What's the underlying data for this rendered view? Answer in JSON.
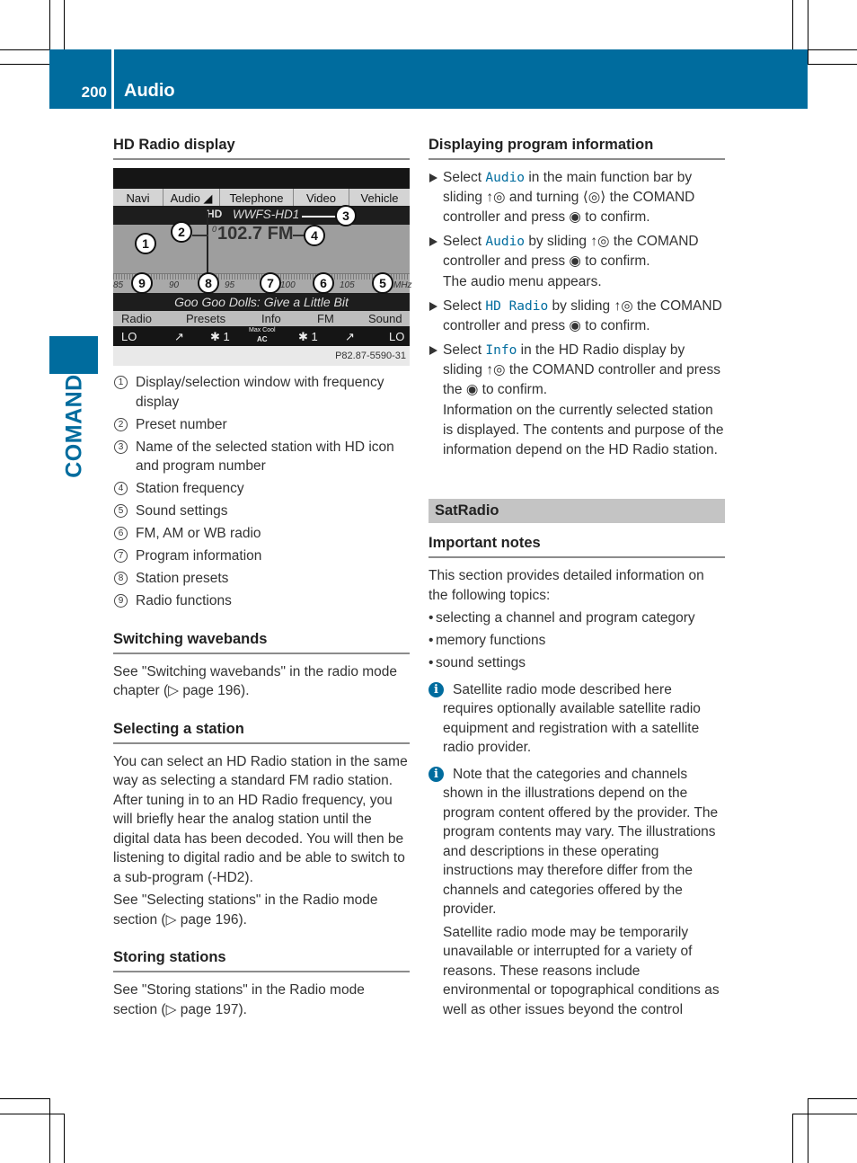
{
  "header": {
    "page_number": "200",
    "title": "Audio"
  },
  "side_tab": {
    "label": "COMAND"
  },
  "left": {
    "hd_display": {
      "heading": "HD Radio display",
      "screen": {
        "menu": [
          "Navi",
          "Audio ◢",
          "Telephone",
          "Video",
          "Vehicle"
        ],
        "station_name": "WWFS-HD1",
        "hd_icon": "HD",
        "preset": "0",
        "frequency": "102.7 FM",
        "scale_labels": [
          "85",
          "90",
          "95",
          "100",
          "105",
          "MHz"
        ],
        "program_info": "Goo Goo Dolls: Give a Little Bit",
        "functions": [
          "Radio",
          "Presets",
          "Info",
          "FM",
          "Sound"
        ],
        "climate": [
          "LO",
          "↗",
          "✱ 1",
          "Max Cool",
          "AC",
          "✱ 1",
          "↗",
          "LO"
        ],
        "image_code": "P82.87-5590-31",
        "callouts": [
          "1",
          "2",
          "3",
          "4",
          "5",
          "6",
          "7",
          "8",
          "9"
        ]
      },
      "legend": [
        {
          "num": "1",
          "text": "Display/selection window with frequency display"
        },
        {
          "num": "2",
          "text": "Preset number"
        },
        {
          "num": "3",
          "text": "Name of the selected station with HD icon and program number"
        },
        {
          "num": "4",
          "text": "Station frequency"
        },
        {
          "num": "5",
          "text": "Sound settings"
        },
        {
          "num": "6",
          "text": "FM, AM or WB radio"
        },
        {
          "num": "7",
          "text": "Program information"
        },
        {
          "num": "8",
          "text": "Station presets"
        },
        {
          "num": "9",
          "text": "Radio functions"
        }
      ]
    },
    "switching": {
      "heading": "Switching wavebands",
      "text": "See \"Switching wavebands\" in the radio mode chapter (▷ page 196)."
    },
    "selecting": {
      "heading": "Selecting a station",
      "text1": "You can select an HD Radio station in the same way as selecting a standard FM radio station. After tuning in to an HD Radio frequency, you will briefly hear the analog station until the digital data has been decoded. You will then be listening to digital radio and be able to switch to a sub-program (-HD2).",
      "text2": "See \"Selecting stations\" in the Radio mode section (▷ page 196)."
    },
    "storing": {
      "heading": "Storing stations",
      "text": "See \"Storing stations\" in the Radio mode section (▷ page 197)."
    }
  },
  "right": {
    "program_info": {
      "heading": "Displaying program information",
      "steps": [
        {
          "pre": "Select ",
          "kw": "Audio",
          "post": " in the main function bar by sliding ↑◎ and turning ⟨◎⟩ the COMAND controller and press ◉ to confirm."
        },
        {
          "pre": "Select ",
          "kw": "Audio",
          "post": " by sliding ↑◎ the COMAND controller and press ◉ to confirm.",
          "result": "The audio menu appears."
        },
        {
          "pre": "Select ",
          "kw": "HD Radio",
          "post": " by sliding ↑◎ the COMAND controller and press ◉ to confirm."
        },
        {
          "pre": "Select ",
          "kw": "Info",
          "post": " in the HD Radio display by sliding ↑◎ the COMAND controller and press the ◉ to confirm.",
          "result": "Information on the currently selected station is displayed. The contents and purpose of the information depend on the HD Radio station."
        }
      ]
    },
    "satradio": {
      "banner": "SatRadio",
      "heading": "Important notes",
      "intro": "This section provides detailed information on the following topics:",
      "bullets": [
        "selecting a channel and program category",
        "memory functions",
        "sound settings"
      ],
      "note1": "Satellite radio mode described here requires optionally available satellite radio equipment and registration with a satellite radio provider.",
      "note2": "Note that the categories and channels shown in the illustrations depend on the program content offered by the provider. The program contents may vary. The illustrations and descriptions in these operating instructions may therefore differ from the channels and categories offered by the provider.",
      "note2_cont": "Satellite radio mode may be temporarily unavailable or interrupted for a variety of reasons. These reasons include environmental or topographical conditions as well as other issues beyond the control"
    }
  },
  "colors": {
    "brand_blue": "#006c9e",
    "banner_gray": "#c4c4c4"
  }
}
